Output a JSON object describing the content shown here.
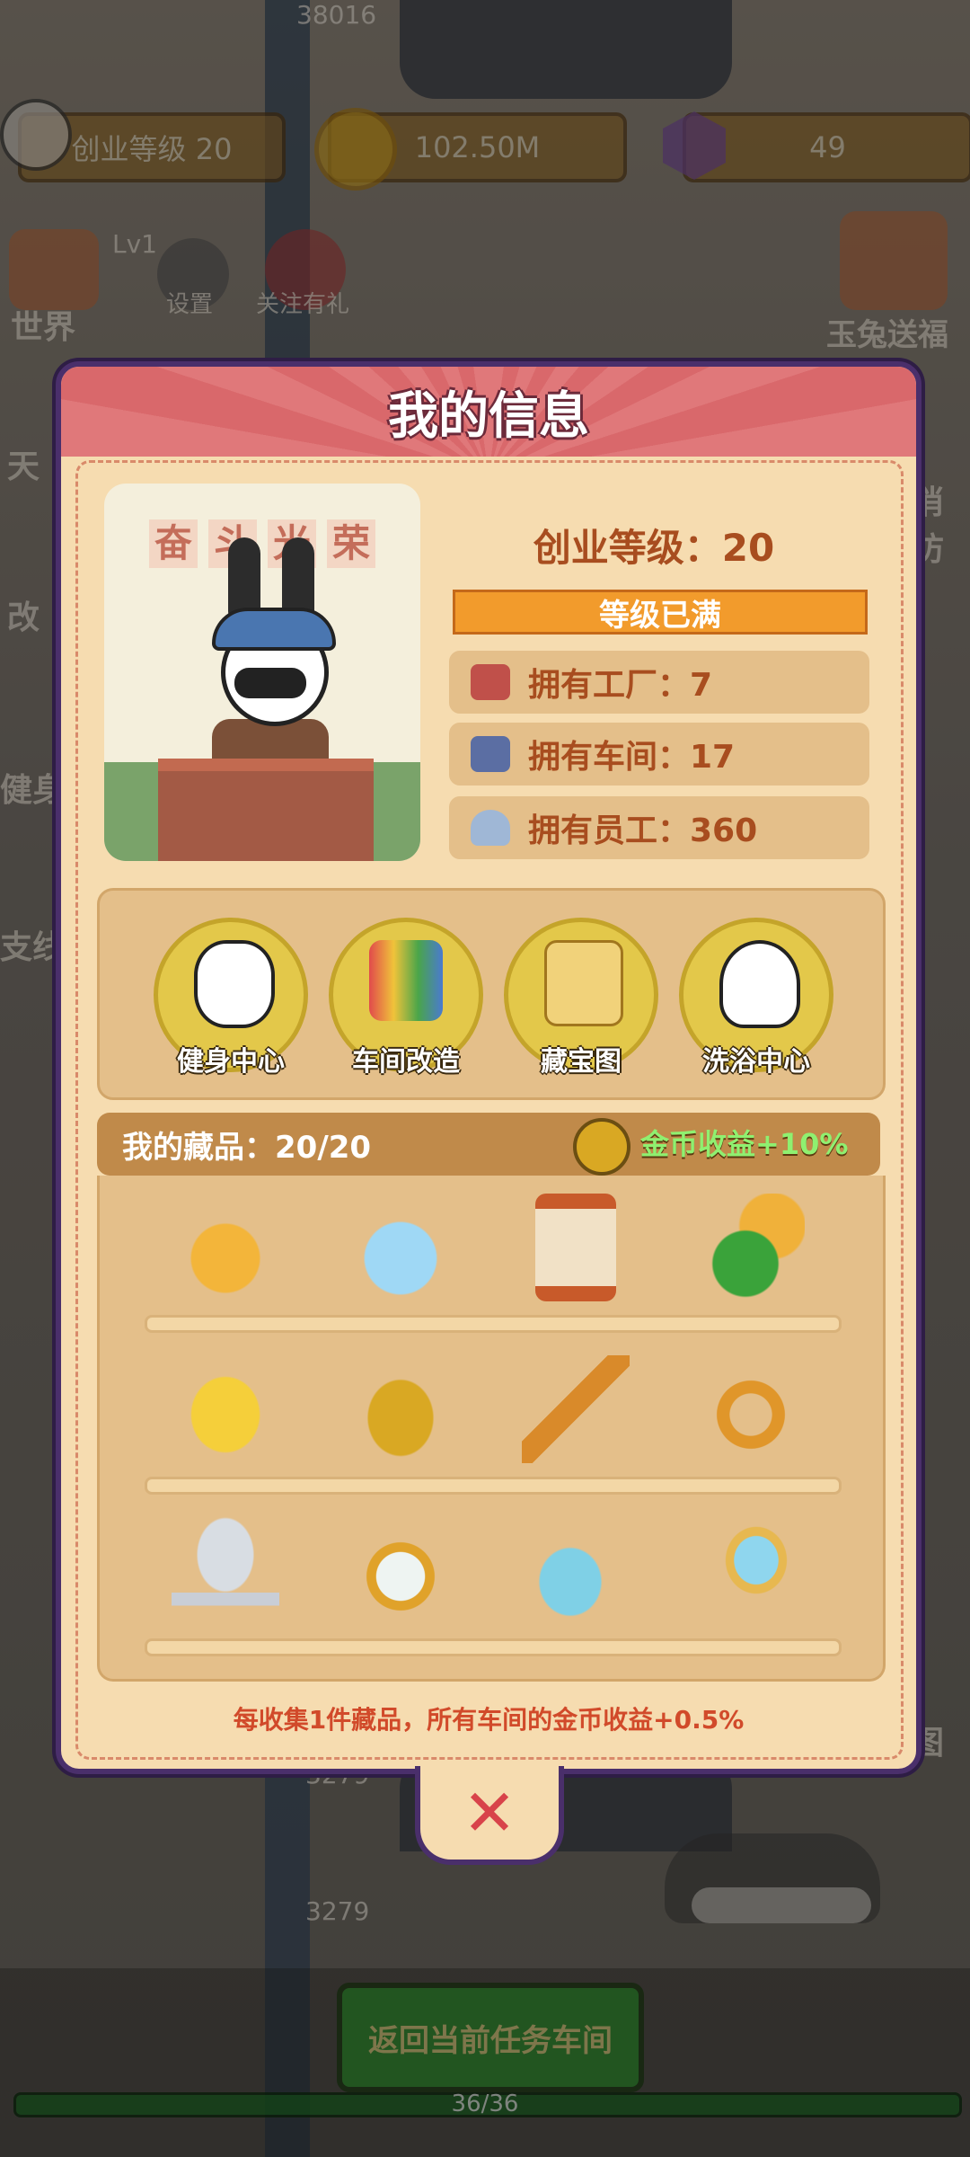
{
  "hud": {
    "level_label": "创业等级 20",
    "coins": "102.50M",
    "gems": "49",
    "counter_top": "38016",
    "counter_mid": "3279",
    "counter_low": "3279"
  },
  "side": {
    "world": "世界",
    "settings": "设置",
    "follow_gift": "关注有礼",
    "jade_rabbit": "玉兔送福",
    "lv": "Lv1",
    "left_partial_1": "天",
    "left_partial_2": "改",
    "left_partial_3": "健身",
    "left_partial_4": "支线",
    "right_partial_1": "消防",
    "right_partial_2": "图"
  },
  "modal": {
    "title": "我的信息",
    "portrait_banner": [
      "奋",
      "斗",
      "光",
      "荣"
    ],
    "level_text": "创业等级：20",
    "level_status": "等级已满",
    "stats": [
      {
        "label": "拥有工厂：7",
        "icon": "factory-icon"
      },
      {
        "label": "拥有车间：17",
        "icon": "workshop-icon"
      },
      {
        "label": "拥有员工：360",
        "icon": "staff-icon"
      }
    ],
    "features": [
      {
        "label": "健身中心",
        "icon": "fitness-rabbit-icon"
      },
      {
        "label": "车间改造",
        "icon": "paint-roller-icon"
      },
      {
        "label": "藏宝图",
        "icon": "treasure-map-icon"
      },
      {
        "label": "洗浴中心",
        "icon": "bath-rabbit-icon"
      }
    ],
    "collection_title": "我的藏品：20/20",
    "collection_bonus": "金币收益+10%",
    "collection_items": [
      [
        "golden-carrot-icon",
        "crystal-swans-icon",
        "hourglass-icon",
        "cornucopia-icon"
      ],
      [
        "golden-egg-icon",
        "jeweled-vase-icon",
        "golden-shovel-icon",
        "gold-ring-icon"
      ],
      [
        "silver-trophy-icon",
        "pocket-watch-icon",
        "message-bottle-icon",
        "hand-mirror-icon"
      ]
    ],
    "footnote": "每收集1件藏品，所有车间的金币收益+0.5%"
  },
  "bottom": {
    "return_button": "返回当前任务车间",
    "progress_text": "36/36",
    "progress_fraction": 1.0
  },
  "colors": {
    "modal_bg": "#f6dcb0",
    "modal_border": "#4a2f6b",
    "title_bar": "#e0787a",
    "accent_orange": "#f29b2c",
    "bonus_green": "#8ff070",
    "footnote_red": "#d14a2a"
  }
}
